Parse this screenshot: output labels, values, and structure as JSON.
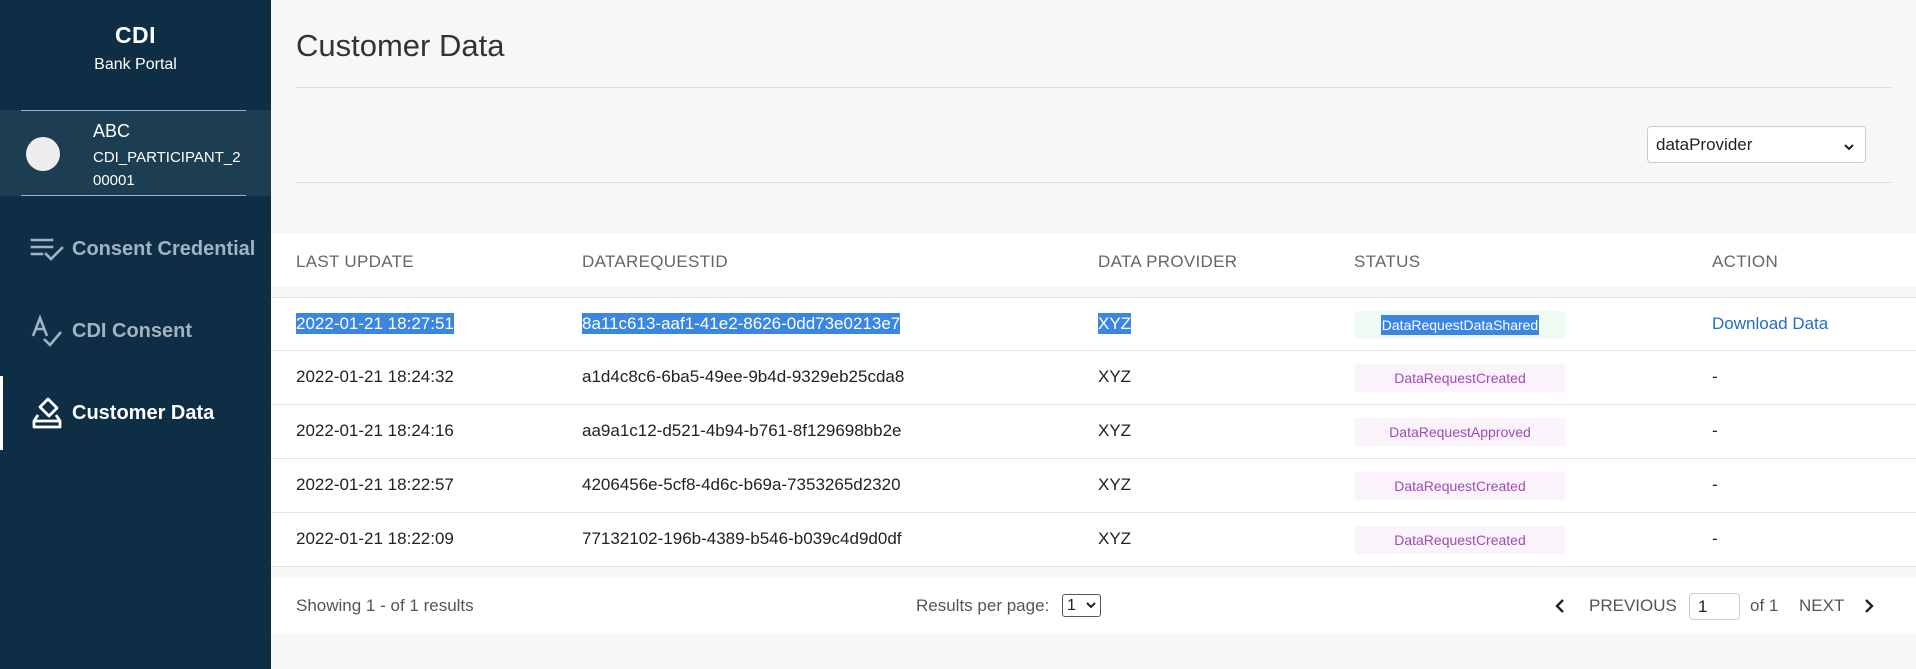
{
  "sidebar": {
    "brand_title": "CDI",
    "brand_subtitle": "Bank Portal",
    "user": {
      "name": "ABC",
      "participant_id": "CDI_PARTICIPANT_200001"
    },
    "nav": [
      {
        "label": "Consent Credential",
        "icon": "checklist-icon",
        "active": false
      },
      {
        "label": "CDI Consent",
        "icon": "spellcheck-icon",
        "active": false
      },
      {
        "label": "Customer Data",
        "icon": "ballot-box-icon",
        "active": true
      }
    ]
  },
  "main": {
    "title": "Customer Data",
    "provider_filter": {
      "selected": "dataProvider"
    },
    "table": {
      "headers": [
        "LAST UPDATE",
        "DATAREQUESTID",
        "DATA PROVIDER",
        "STATUS",
        "ACTION"
      ],
      "rows": [
        {
          "last_update": "2022-01-21 18:27:51",
          "request_id": "8a11c613-aaf1-41e2-8626-0dd73e0213e7",
          "provider": "XYZ",
          "status": "DataRequestDataShared",
          "action": "Download Data"
        },
        {
          "last_update": "2022-01-21 18:24:32",
          "request_id": "a1d4c8c6-6ba5-49ee-9b4d-9329eb25cda8",
          "provider": "XYZ",
          "status": "DataRequestCreated",
          "action": "-"
        },
        {
          "last_update": "2022-01-21 18:24:16",
          "request_id": "aa9a1c12-d521-4b94-b761-8f129698bb2e",
          "provider": "XYZ",
          "status": "DataRequestApproved",
          "action": "-"
        },
        {
          "last_update": "2022-01-21 18:22:57",
          "request_id": "4206456e-5cf8-4d6c-b69a-7353265d2320",
          "provider": "XYZ",
          "status": "DataRequestCreated",
          "action": "-"
        },
        {
          "last_update": "2022-01-21 18:22:09",
          "request_id": "77132102-196b-4389-b546-b039c4d9d0df",
          "provider": "XYZ",
          "status": "DataRequestCreated",
          "action": "-"
        }
      ]
    },
    "footer": {
      "showing": "Showing 1 - of 1 results",
      "results_per_page_label": "Results per page:",
      "results_per_page_value": "1",
      "previous_label": "PREVIOUS",
      "current_page": "1",
      "of_label": "of 1",
      "next_label": "NEXT"
    }
  },
  "colors": {
    "sidebar_bg": "#0d2e44",
    "selection": "#3b86e0",
    "link": "#1f6fc4",
    "status_purple": "#a04ab8"
  }
}
